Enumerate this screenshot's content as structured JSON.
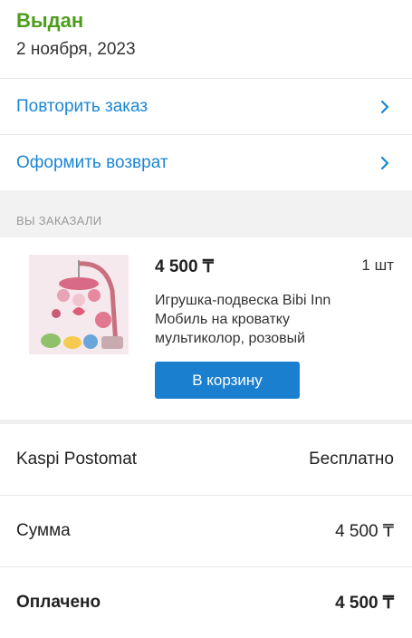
{
  "order": {
    "status": "Выдан",
    "date": "2 ноября, 2023",
    "status_color": "#4c9d1c"
  },
  "actions": [
    {
      "label": "Повторить заказ",
      "icon": "chevron-right-icon"
    },
    {
      "label": "Оформить возврат",
      "icon": "chevron-right-icon"
    }
  ],
  "accent_color": "#1b86d3",
  "ordered": {
    "section_title": "ВЫ ЗАКАЗАЛИ",
    "item": {
      "price": "4 500 ₸",
      "quantity": "1 шт",
      "name": "Игрушка-подвеска Bibi Inn Мобиль на кроватку мультиколор, розовый",
      "cart_button": "В корзину"
    }
  },
  "summary": [
    {
      "label": "Kaspi Postomat",
      "value": "Бесплатно"
    },
    {
      "label": "Сумма",
      "value": "4 500 ₸"
    },
    {
      "label": "Оплачено",
      "value": "4 500 ₸"
    }
  ]
}
